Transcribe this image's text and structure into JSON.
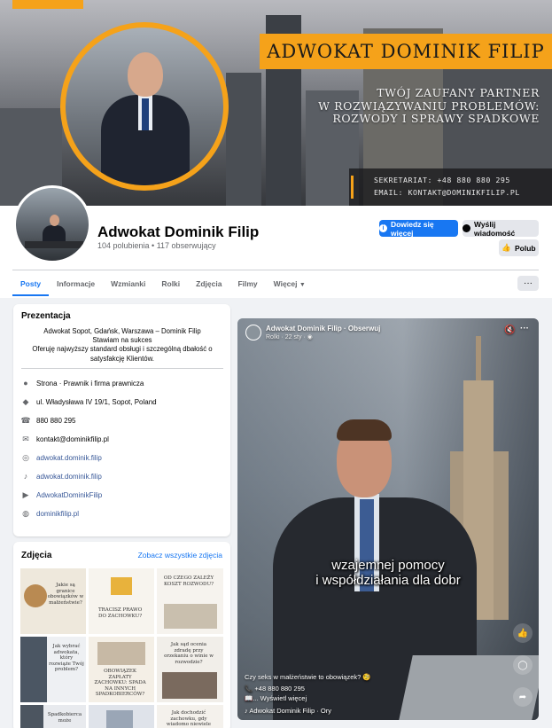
{
  "cover": {
    "banner_title": "ADWOKAT DOMINIK FILIP",
    "tagline": [
      "TWÓJ ZAUFANY PARTNER",
      "W ROZWIĄZYWANIU PROBLEMÓW:",
      "ROZWODY I SPRAWY SPADKOWE"
    ],
    "secretariat": "SEKRETARIAT: +48 880 880 295",
    "email": "EMAIL: KONTAKT@DOMINIKFILIP.PL",
    "accent": "#f5a21a"
  },
  "profile": {
    "name": "Adwokat Dominik Filip",
    "stats": "104 polubienia • 117 obserwujący",
    "learn_more_label": "Dowiedz się więcej",
    "message_label": "Wyślij wiadomość",
    "like_label": "Polub",
    "primary_color": "#1877f2"
  },
  "tabs": {
    "items": [
      "Posty",
      "Informacje",
      "Wzmianki",
      "Rolki",
      "Zdjęcia",
      "Filmy",
      "Więcej"
    ],
    "active": "Posty",
    "more_menu": "···"
  },
  "intro": {
    "title": "Prezentacja",
    "bio": [
      "Adwokat Sopot, Gdańsk, Warszawa – Dominik Filip",
      "Stawiam na sukces",
      "Oferuję najwyższy standard obsługi i szczególną dbałość o satysfakcję Klientów."
    ],
    "rows": [
      {
        "icon": "info-icon",
        "text": "Strona · Prawnik i firma prawnicza",
        "link": false
      },
      {
        "icon": "location-icon",
        "text": "ul. Władysława IV 19/1, Sopot, Poland",
        "link": false
      },
      {
        "icon": "phone-icon",
        "text": "880 880 295",
        "link": false
      },
      {
        "icon": "email-icon",
        "text": "kontakt@dominikfilip.pl",
        "link": false
      },
      {
        "icon": "instagram-icon",
        "text": "adwokat.dominik.filip",
        "link": true
      },
      {
        "icon": "tiktok-icon",
        "text": "adwokat.dominik.filip",
        "link": true
      },
      {
        "icon": "youtube-icon",
        "text": "AdwokatDominikFilip",
        "link": true
      },
      {
        "icon": "globe-icon",
        "text": "dominikfilip.pl",
        "link": true
      }
    ]
  },
  "photos": {
    "title": "Zdjęcia",
    "see_all": "Zobacz wszystkie zdjęcia",
    "thumbs": [
      "Jakie są granice obowiązków w małżeństwie?",
      "TRACISZ PRAWO DO ZACHOWKU?",
      "OD CZEGO ZALEŻY KOSZT ROZWODU?",
      "Jak wybrać adwokata, który rozwiąże Twój problem?",
      "OBOWIĄZEK ZAPŁATY ZACHOWKU: SPADA NA INNYCH SPADKOBIERCÓW?",
      "Jak sąd ocenia zdradę przy orzekaniu o winie w rozwodzie?",
      "Spadkobierca może",
      "",
      "Jak dochodzić zachowku, gdy wiadomo niewiele"
    ]
  },
  "video": {
    "author": "Adwokat Dominik Filip · Obserwuj",
    "meta": "Rolki · 22 sty · ◉",
    "subtitle": [
      "wzajemnej pomocy",
      "i współdziałania dla dobr"
    ],
    "caption_question": "Czy seks w małżeństwie to obowiązek? 🧐",
    "caption_phone": "📞 +48 880 880 295",
    "caption_more": "📖... Wyświetl więcej",
    "caption_audio": "♪ Adwokat Dominik Filip · Ory"
  }
}
